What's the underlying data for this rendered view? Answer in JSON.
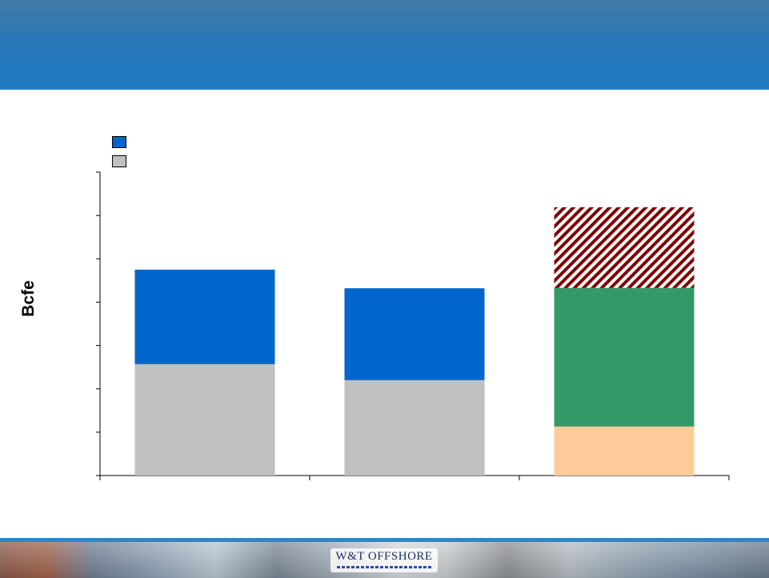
{
  "slide": {
    "title": "",
    "logo_text": "W&T OFFSHORE"
  },
  "colors": {
    "header": "#1f7bc4",
    "series_blue": "#0066cc",
    "series_gray": "#c0c0c0",
    "series_peach": "#ffcc99",
    "series_green": "#339966",
    "series_hatch": "#800000",
    "footer_line": "#2d86c8"
  },
  "chart_data": {
    "type": "bar",
    "stacked": true,
    "title": "",
    "xlabel": "",
    "ylabel": "Bcfe",
    "ylim": [
      0,
      7
    ],
    "y_ticks": [
      0,
      1,
      2,
      3,
      4,
      5,
      6,
      7
    ],
    "categories": [
      "",
      "",
      ""
    ],
    "legend_placement": "top-left",
    "series": [
      {
        "name": "",
        "color": "#c0c0c0",
        "fill": "solid",
        "values": [
          2.57,
          2.2,
          0
        ]
      },
      {
        "name": "",
        "color": "#0066cc",
        "fill": "solid",
        "values": [
          2.18,
          2.12,
          0
        ]
      },
      {
        "name": "",
        "color": "#ffcc99",
        "fill": "solid",
        "values": [
          0,
          0,
          1.13
        ]
      },
      {
        "name": "",
        "color": "#339966",
        "fill": "solid",
        "values": [
          0,
          0,
          3.2
        ]
      },
      {
        "name": "",
        "color": "#800000",
        "fill": "hatch",
        "values": [
          0,
          0,
          1.86
        ]
      }
    ],
    "legend": [
      {
        "label": "",
        "color": "#0066cc"
      },
      {
        "label": "",
        "color": "#c0c0c0"
      }
    ]
  }
}
